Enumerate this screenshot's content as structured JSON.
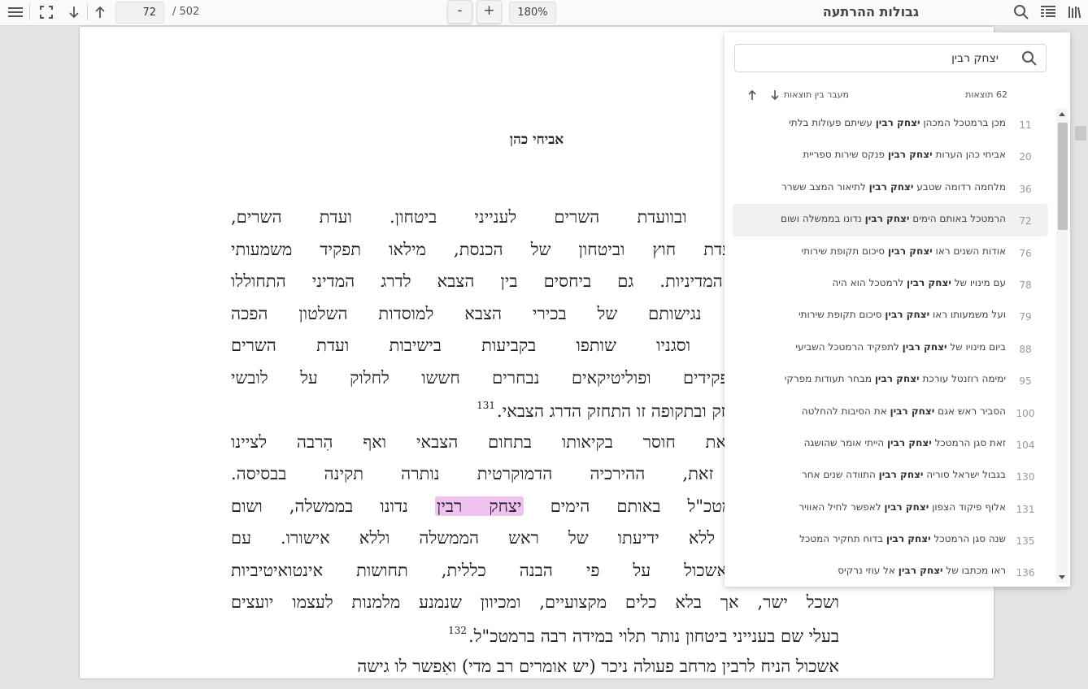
{
  "toolbar": {
    "current_page": "72",
    "total_pages": "/ 502",
    "zoom_out_label": "-",
    "zoom_in_label": "+",
    "zoom_level": "180%",
    "document_title": "גבולות ההרתעה",
    "icons": [
      "menu-icon",
      "fullscreen-icon",
      "arrow-down-icon",
      "arrow-up-icon",
      "search-icon",
      "outline-icon",
      "library-icon"
    ]
  },
  "page": {
    "author": "אביחי כהן",
    "lines": [
      {
        "text": "תיו לממשלה ובוועדת השרים לענייני ביטחון. ועדת השרים,"
      },
      {
        "text": "גם חברי ועדת חוץ וביטחון של הכנסת, מילאו תפקיד משמעותי"
      },
      {
        "text": "ל להתוויית המדיניות. גם ביחסים בין הצבא לדרג המדיני התחוללו"
      },
      {
        "text": "בימי אשכול: נגישותם של בכירי הצבא למוסדות השלטון הפכה"
      },
      {
        "text": "- הרמטכ\"ל וסגניו שותפו בקביעות בישיבות ועדת השרים"
      },
      {
        "text": ", בעלי תפקידים ופוליטיקאים נבחרים חששו לחלוק על לובשי"
      },
      {
        "text": "הרמטכ\"לות התחזק ובתקופה זו התחזק הדרג הצבאי.",
        "footnote": "131",
        "short": true
      },
      {
        "text": "א הסתיר את חוסר בקיאותו בתחום הצבאי ואף הִרבה לציינו"
      },
      {
        "text": "מטי. עם זאת, ההירכיה הדמוקרטית נותרה תקינה בבסיסה."
      },
      {
        "text_before": "ית של הרמטכ\"ל באותם הימים",
        "highlight": "יצחק רבין",
        "text_after": "נדונו בממשלה, ושום"
      },
      {
        "text": "לא נעשתה ללא ידיעתו של ראש הממשלה וללא אישורו. עם"
      },
      {
        "text": "חון פעל אשכול על פי הבנה כללית, תחושות אינטואיטיביות"
      },
      {
        "text": "ושכל ישר, אך בלא כלים מקצועיים, ומכיוון שנמנע מלמנות לעצמו יועצים"
      },
      {
        "text": "בעלי שם בענייני ביטחון נותר תלוי במידה רבה ברמטכ\"ל.",
        "footnote": "132",
        "short": true
      },
      {
        "text": "אשכול הניח לרבין מרחב פעולה ניכר (יש אומרים רב מדי) ואִפשר לו גישה",
        "short": true
      }
    ]
  },
  "search": {
    "query": "יצחק רבין",
    "result_count": "62 תוצאות",
    "nav_label": "מעבר בין תוצאות",
    "results": [
      {
        "page": "11",
        "before": "מכן ברמטכל המכהן",
        "match": "יצחק רבין",
        "after": "עשיתם פעולות בלתי"
      },
      {
        "page": "20",
        "before": "אביחי כהן הערות",
        "match": "יצחק רבין",
        "after": "פנקס שירות ספריית"
      },
      {
        "page": "36",
        "before": "מלחמה רדומה שטבע",
        "match": "יצחק רבין",
        "after": "לתיאור המצב ששרר"
      },
      {
        "page": "72",
        "before": "הרמטכל באותם הימים",
        "match": "יצחק רבין",
        "after": "נדונו בממשלה ושום",
        "active": true
      },
      {
        "page": "76",
        "before": "אודות השנים ראו",
        "match": "יצחק רבין",
        "after": "סיכום תקופת שירותי"
      },
      {
        "page": "78",
        "before": "עם מינויו של",
        "match": "יצחק רבין",
        "after": "לרמטכל הוא היה"
      },
      {
        "page": "79",
        "before": "ועל משמעותו ראו",
        "match": "יצחק רבין",
        "after": "סיכום תקופת שירותי"
      },
      {
        "page": "88",
        "before": "ביום מינויו של",
        "match": "יצחק רבין",
        "after": "לתפקיד הרמטכל השביעי"
      },
      {
        "page": "95",
        "before": "ימימה רוזנטל עורכת",
        "match": "יצחק רבין",
        "after": "מבחר תעודות מפרקי"
      },
      {
        "page": "100",
        "before": "הסביר ראש אגם",
        "match": "יצחק רבין",
        "after": "את הסיבות להחלטה"
      },
      {
        "page": "104",
        "before": "זאת סגן הרמטכל",
        "match": "יצחק רבין",
        "after": "הייתי אומר שהושגה"
      },
      {
        "page": "130",
        "before": "בגבול ישראל סוריה",
        "match": "יצחק רבין",
        "after": "התוודה שנים אחר"
      },
      {
        "page": "131",
        "before": "אלוף פיקוד הצפון",
        "match": "יצחק רבין",
        "after": "לאפשר לחיל האוויר"
      },
      {
        "page": "135",
        "before": "שנה סגן הרמטכל",
        "match": "יצחק רבין",
        "after": "בדוח תחקיר המטכל"
      },
      {
        "page": "136",
        "before": "ראו מכתבו של",
        "match": "יצחק רבין",
        "after": "אל עוזי נרקיס"
      }
    ]
  },
  "colors": {
    "highlight": "#f0c2f0",
    "toolbar_bg": "#fafafa",
    "viewer_bg": "#e4e4e4",
    "active_result_bg": "#f0f0f0"
  }
}
